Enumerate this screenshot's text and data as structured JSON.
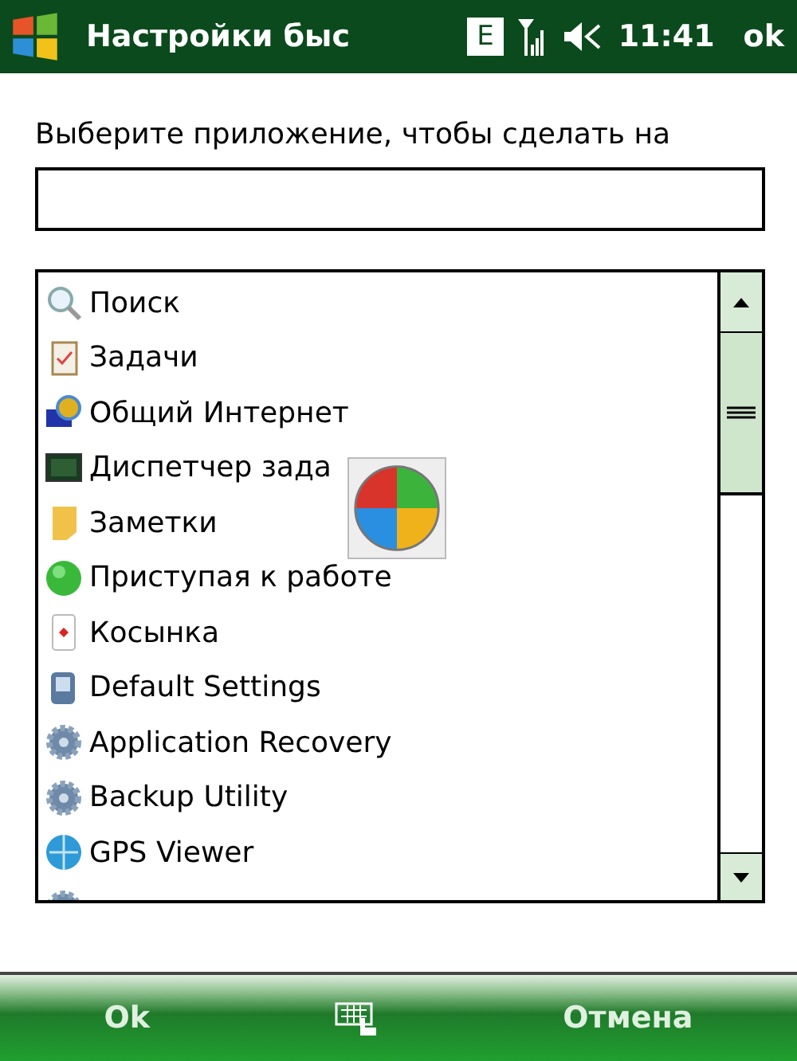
{
  "status_bar": {
    "title": "Настройки быс",
    "network": "E",
    "time": "11:41",
    "ok": "ok"
  },
  "prompt": "Выберите приложение, чтобы сделать на",
  "list": {
    "items": [
      {
        "kind": "search",
        "label": "Поиск"
      },
      {
        "kind": "tasks",
        "label": "Задачи"
      },
      {
        "kind": "sharing",
        "label": "Общий Интернет"
      },
      {
        "kind": "monitor",
        "label": "Диспетчер зада"
      },
      {
        "kind": "notes",
        "label": "Заметки"
      },
      {
        "kind": "ball",
        "label": "Приступая к работе"
      },
      {
        "kind": "card",
        "label": "Косынка"
      },
      {
        "kind": "device",
        "label": "Default Settings"
      },
      {
        "kind": "gear",
        "label": "Application Recovery"
      },
      {
        "kind": "gear",
        "label": "Backup Utility"
      },
      {
        "kind": "globe",
        "label": "GPS Viewer"
      },
      {
        "kind": "gear"
      }
    ]
  },
  "softkeys": {
    "left": "Ok",
    "right": "Отмена"
  }
}
